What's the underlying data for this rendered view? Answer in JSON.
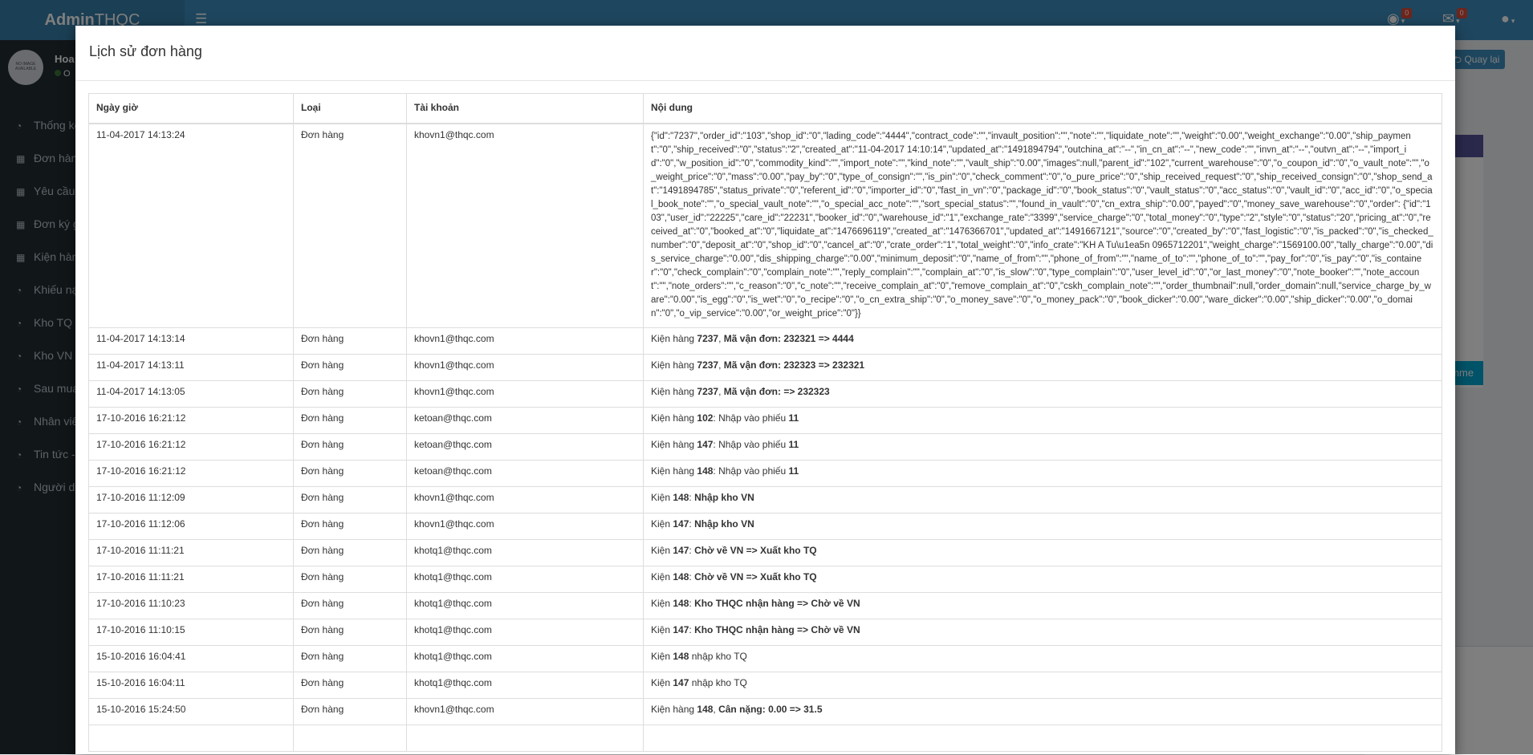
{
  "app": {
    "logo_bold": "Admin",
    "logo_rest": "THQC",
    "notifications_count": "0",
    "messages_count": "0",
    "user": {
      "name": "Hoa",
      "status": "O",
      "avatar_text": "NO IMAGE AVAILABLE"
    },
    "back_button": "Quay lại",
    "bg_button": "omme",
    "sidebar": [
      {
        "label": "Thống kê"
      },
      {
        "label": "Đơn hàng"
      },
      {
        "label": "Yêu cầu k"
      },
      {
        "label": "Đơn ký gử"
      },
      {
        "label": "Kiện hàng"
      },
      {
        "label": "Khiếu nại"
      },
      {
        "label": "Kho TQ / "
      },
      {
        "label": "Kho VN"
      },
      {
        "label": "Sau mua h"
      },
      {
        "label": "Nhân viên"
      },
      {
        "label": "Tin tức - t"
      },
      {
        "label": "Người dùn"
      }
    ]
  },
  "modal": {
    "title": "Lịch sử đơn hàng",
    "columns": [
      "Ngày giờ",
      "Loại",
      "Tài khoản",
      "Nội dung"
    ],
    "rows": [
      {
        "date": "11-04-2017 14:13:24",
        "type": "Đơn hàng",
        "account": "khovn1@thqc.com",
        "content": "{\"id\":\"7237\",\"order_id\":\"103\",\"shop_id\":\"0\",\"lading_code\":\"4444\",\"contract_code\":\"\",\"invault_position\":\"\",\"note\":\"\",\"liquidate_note\":\"\",\"weight\":\"0.00\",\"weight_exchange\":\"0.00\",\"ship_payment\":\"0\",\"ship_received\":\"0\",\"status\":\"2\",\"created_at\":\"11-04-2017 14:10:14\",\"updated_at\":\"1491894794\",\"outchina_at\":\"--\",\"in_cn_at\":\"--\",\"new_code\":\"\",\"invn_at\":\"--\",\"outvn_at\":\"--\",\"import_id\":\"0\",\"w_position_id\":\"0\",\"commodity_kind\":\"\",\"import_note\":\"\",\"kind_note\":\"\",\"vault_ship\":\"0.00\",\"images\":null,\"parent_id\":\"102\",\"current_warehouse\":\"0\",\"o_coupon_id\":\"0\",\"o_vault_note\":\"\",\"o_weight_price\":\"0\",\"mass\":\"0.00\",\"pay_by\":\"0\",\"type_of_consign\":\"\",\"is_pin\":\"0\",\"check_comment\":\"0\",\"o_pure_price\":\"0\",\"ship_received_request\":\"0\",\"ship_received_consign\":\"0\",\"shop_send_at\":\"1491894785\",\"status_private\":\"0\",\"referent_id\":\"0\",\"importer_id\":\"0\",\"fast_in_vn\":\"0\",\"package_id\":\"0\",\"book_status\":\"0\",\"vault_status\":\"0\",\"acc_status\":\"0\",\"vault_id\":\"0\",\"acc_id\":\"0\",\"o_special_book_note\":\"\",\"o_special_vault_note\":\"\",\"o_special_acc_note\":\"\",\"sort_special_status\":\"\",\"found_in_vault\":\"0\",\"cn_extra_ship\":\"0.00\",\"payed\":\"0\",\"money_save_warehouse\":\"0\",\"order\": {\"id\":\"103\",\"user_id\":\"22225\",\"care_id\":\"22231\",\"booker_id\":\"0\",\"warehouse_id\":\"1\",\"exchange_rate\":\"3399\",\"service_charge\":\"0\",\"total_money\":\"0\",\"type\":\"2\",\"style\":\"0\",\"status\":\"20\",\"pricing_at\":\"0\",\"received_at\":\"0\",\"booked_at\":\"0\",\"liquidate_at\":\"1476696119\",\"created_at\":\"1476366701\",\"updated_at\":\"1491667121\",\"source\":\"0\",\"created_by\":\"0\",\"fast_logistic\":\"0\",\"is_packed\":\"0\",\"is_checked_number\":\"0\",\"deposit_at\":\"0\",\"shop_id\":\"0\",\"cancel_at\":\"0\",\"crate_order\":\"1\",\"total_weight\":\"0\",\"info_crate\":\"KH A Tu\\u1ea5n 0965712201\",\"weight_charge\":\"1569100.00\",\"tally_charge\":\"0.00\",\"dis_service_charge\":\"0.00\",\"dis_shipping_charge\":\"0.00\",\"minimum_deposit\":\"0\",\"name_of_from\":\"\",\"phone_of_from\":\"\",\"name_of_to\":\"\",\"phone_of_to\":\"\",\"pay_for\":\"0\",\"is_pay\":\"0\",\"is_container\":\"0\",\"check_complain\":\"0\",\"complain_note\":\"\",\"reply_complain\":\"\",\"complain_at\":\"0\",\"is_slow\":\"0\",\"type_complain\":\"0\",\"user_level_id\":\"0\",\"or_last_money\":\"0\",\"note_booker\":\"\",\"note_account\":\"\",\"note_orders\":\"\",\"c_reason\":\"0\",\"c_note\":\"\",\"receive_complain_at\":\"0\",\"remove_complain_at\":\"0\",\"cskh_complain_note\":\"\",\"order_thumbnail\":null,\"order_domain\":null,\"service_charge_by_ware\":\"0.00\",\"is_egg\":\"0\",\"is_wet\":\"0\",\"o_recipe\":\"0\",\"o_cn_extra_ship\":\"0\",\"o_money_save\":\"0\",\"o_money_pack\":\"0\",\"book_dicker\":\"0.00\",\"ware_dicker\":\"0.00\",\"ship_dicker\":\"0.00\",\"o_domain\":\"0\",\"o_vip_service\":\"0.00\",\"or_weight_price\":\"0\"}}"
      },
      {
        "date": "11-04-2017 14:13:14",
        "type": "Đơn hàng",
        "account": "khovn1@thqc.com",
        "content_parts": [
          {
            "t": "Kiện hàng "
          },
          {
            "t": "7237",
            "b": true
          },
          {
            "t": ", "
          },
          {
            "t": "Mã vận đơn",
            "b": true
          },
          {
            "t": ": 232321 => 4444",
            "b": true
          }
        ]
      },
      {
        "date": "11-04-2017 14:13:11",
        "type": "Đơn hàng",
        "account": "khovn1@thqc.com",
        "content_parts": [
          {
            "t": "Kiện hàng "
          },
          {
            "t": "7237",
            "b": true
          },
          {
            "t": ", "
          },
          {
            "t": "Mã vận đơn",
            "b": true
          },
          {
            "t": ": 232323 => 232321",
            "b": true
          }
        ]
      },
      {
        "date": "11-04-2017 14:13:05",
        "type": "Đơn hàng",
        "account": "khovn1@thqc.com",
        "content_parts": [
          {
            "t": "Kiện hàng "
          },
          {
            "t": "7237",
            "b": true
          },
          {
            "t": ", "
          },
          {
            "t": "Mã vận đơn",
            "b": true
          },
          {
            "t": ": => 232323",
            "b": true
          }
        ]
      },
      {
        "date": "17-10-2016 16:21:12",
        "type": "Đơn hàng",
        "account": "ketoan@thqc.com",
        "content_parts": [
          {
            "t": "Kiện hàng "
          },
          {
            "t": "102",
            "b": true
          },
          {
            "t": ": Nhập vào phiếu "
          },
          {
            "t": "11",
            "b": true
          }
        ]
      },
      {
        "date": "17-10-2016 16:21:12",
        "type": "Đơn hàng",
        "account": "ketoan@thqc.com",
        "content_parts": [
          {
            "t": "Kiện hàng "
          },
          {
            "t": "147",
            "b": true
          },
          {
            "t": ": Nhập vào phiếu "
          },
          {
            "t": "11",
            "b": true
          }
        ]
      },
      {
        "date": "17-10-2016 16:21:12",
        "type": "Đơn hàng",
        "account": "ketoan@thqc.com",
        "content_parts": [
          {
            "t": "Kiện hàng "
          },
          {
            "t": "148",
            "b": true
          },
          {
            "t": ": Nhập vào phiếu "
          },
          {
            "t": "11",
            "b": true
          }
        ]
      },
      {
        "date": "17-10-2016 11:12:09",
        "type": "Đơn hàng",
        "account": "khovn1@thqc.com",
        "content_parts": [
          {
            "t": "Kiện "
          },
          {
            "t": "148",
            "b": true
          },
          {
            "t": ": "
          },
          {
            "t": "Nhập kho VN",
            "b": true
          }
        ]
      },
      {
        "date": "17-10-2016 11:12:06",
        "type": "Đơn hàng",
        "account": "khovn1@thqc.com",
        "content_parts": [
          {
            "t": "Kiện "
          },
          {
            "t": "147",
            "b": true
          },
          {
            "t": ": "
          },
          {
            "t": "Nhập kho VN",
            "b": true
          }
        ]
      },
      {
        "date": "17-10-2016 11:11:21",
        "type": "Đơn hàng",
        "account": "khotq1@thqc.com",
        "content_parts": [
          {
            "t": "Kiện "
          },
          {
            "t": "147",
            "b": true
          },
          {
            "t": ": "
          },
          {
            "t": "Chờ về VN => Xuất kho TQ",
            "b": true
          }
        ]
      },
      {
        "date": "17-10-2016 11:11:21",
        "type": "Đơn hàng",
        "account": "khotq1@thqc.com",
        "content_parts": [
          {
            "t": "Kiện "
          },
          {
            "t": "148",
            "b": true
          },
          {
            "t": ": "
          },
          {
            "t": "Chờ về VN => Xuất kho TQ",
            "b": true
          }
        ]
      },
      {
        "date": "17-10-2016 11:10:23",
        "type": "Đơn hàng",
        "account": "khotq1@thqc.com",
        "content_parts": [
          {
            "t": "Kiện "
          },
          {
            "t": "148",
            "b": true
          },
          {
            "t": ": "
          },
          {
            "t": "Kho THQC nhận hàng => Chờ về VN",
            "b": true
          }
        ]
      },
      {
        "date": "17-10-2016 11:10:15",
        "type": "Đơn hàng",
        "account": "khotq1@thqc.com",
        "content_parts": [
          {
            "t": "Kiện "
          },
          {
            "t": "147",
            "b": true
          },
          {
            "t": ": "
          },
          {
            "t": "Kho THQC nhận hàng => Chờ về VN",
            "b": true
          }
        ]
      },
      {
        "date": "15-10-2016 16:04:41",
        "type": "Đơn hàng",
        "account": "khotq1@thqc.com",
        "content_parts": [
          {
            "t": "Kiện "
          },
          {
            "t": "148",
            "b": true
          },
          {
            "t": " nhập kho TQ"
          }
        ]
      },
      {
        "date": "15-10-2016 16:04:11",
        "type": "Đơn hàng",
        "account": "khotq1@thqc.com",
        "content_parts": [
          {
            "t": "Kiện "
          },
          {
            "t": "147",
            "b": true
          },
          {
            "t": " nhập kho TQ"
          }
        ]
      },
      {
        "date": "15-10-2016 15:24:50",
        "type": "Đơn hàng",
        "account": "khovn1@thqc.com",
        "content_parts": [
          {
            "t": "Kiện hàng "
          },
          {
            "t": "148",
            "b": true
          },
          {
            "t": ", "
          },
          {
            "t": "Cân nặng",
            "b": true
          },
          {
            "t": ": 0.00 => 31.5",
            "b": true
          }
        ]
      },
      {
        "date": "",
        "type": "",
        "account": "",
        "content_parts": [
          {
            "t": ""
          }
        ]
      }
    ]
  }
}
